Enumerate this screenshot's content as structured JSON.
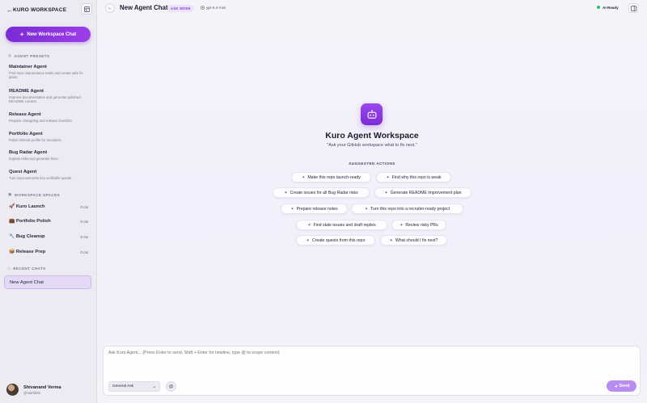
{
  "sidebar": {
    "title": "KURO WORKSPACE",
    "new_chat_label": "New Workspace Chat",
    "presets_label": "AGENT PRESETS",
    "presets": [
      {
        "title": "Maintainer Agent",
        "desc": "First repo maintenance tasks and create safe fix plans."
      },
      {
        "title": "README Agent",
        "desc": "Improve documentation and generate polished README content."
      },
      {
        "title": "Release Agent",
        "desc": "Prepare changelog and release checklist."
      },
      {
        "title": "Portfolio Agent",
        "desc": "Polish GitHub profile for recruiters."
      },
      {
        "title": "Bug Radar Agent",
        "desc": "Explain risks and generate fixes."
      },
      {
        "title": "Quest Agent",
        "desc": "Turn improvements into verifiable quests."
      }
    ],
    "spaces_label": "WORKSPACE SPACES",
    "spaces": [
      {
        "name": "🚀 Kuro Launch",
        "count": "0 ctx"
      },
      {
        "name": "💼 Portfolio Polish",
        "count": "0 ctx"
      },
      {
        "name": "🔧 Bug Cleanup",
        "count": "0 ctx"
      },
      {
        "name": "📦 Release Prep",
        "count": "0 ctx"
      }
    ],
    "recent_label": "RECENT CHATS",
    "recent": [
      {
        "title": "New Agent Chat"
      }
    ],
    "user": {
      "name": "Shivanand Verma",
      "handle": "@starkbbk"
    }
  },
  "header": {
    "title": "New Agent Chat",
    "mode": "ASK MODE",
    "model": "gpt-5.4-mini",
    "status": "AI Ready"
  },
  "hero": {
    "title": "Kuro Agent Workspace",
    "subtitle": "\"Ask your GitHub workspace what to fix next.\"",
    "actions_label": "SUGGESTED ACTIONS"
  },
  "suggestions": [
    "Make this repo launch-ready",
    "Find why this repo is weak",
    "Create issues for all Bug Radar risks",
    "Generate README improvement plan",
    "Prepare release notes",
    "Turn this repo into a recruiter-ready project",
    "Find stale issues and draft replies",
    "Review risky PRs",
    "Create quests from this repo",
    "What should I fix next?"
  ],
  "composer": {
    "placeholder": "Ask Kuro Agent... (Press Enter to send, Shift + Enter for newline, type @ to scope context)",
    "mode_select": "General Ask",
    "send_label": "Send"
  },
  "colors": {
    "accent": "#8a3fd6",
    "status": "#2fbf62"
  }
}
